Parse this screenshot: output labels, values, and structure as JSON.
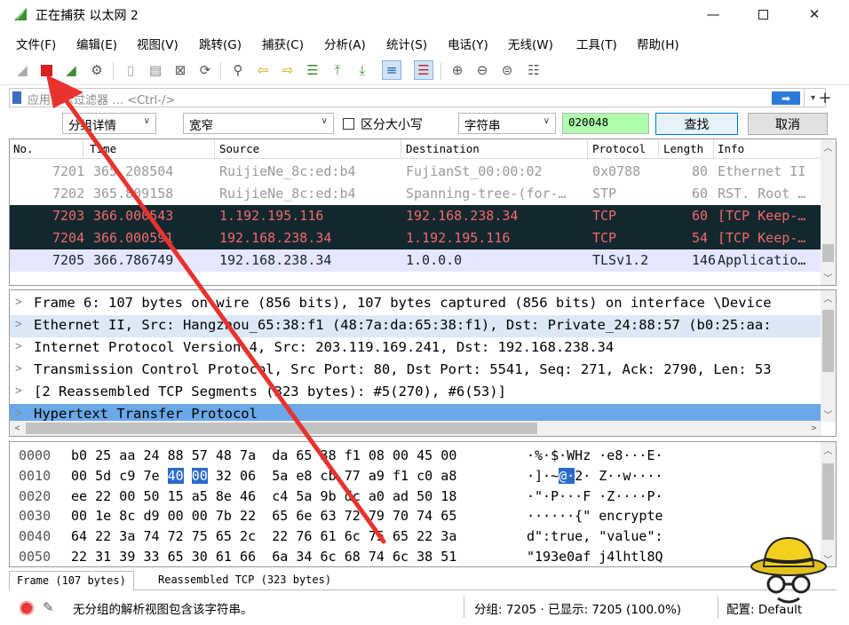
{
  "window": {
    "title": "正在捕获 以太网 2"
  },
  "menubar": [
    {
      "label": "文件(F)"
    },
    {
      "label": "编辑(E)"
    },
    {
      "label": "视图(V)"
    },
    {
      "label": "跳转(G)"
    },
    {
      "label": "捕获(C)"
    },
    {
      "label": "分析(A)"
    },
    {
      "label": "统计(S)"
    },
    {
      "label": "电话(Y)"
    },
    {
      "label": "无线(W)"
    },
    {
      "label": "工具(T)"
    },
    {
      "label": "帮助(H)"
    }
  ],
  "filter": {
    "placeholder": "应用显示过滤器 … <Ctrl-/>"
  },
  "find": {
    "scope": "分组详情",
    "charset": "宽窄",
    "case_label": "区分大小写",
    "type": "字符串",
    "value": "020048",
    "find_button": "查找",
    "cancel_button": "取消"
  },
  "columns": [
    "No.",
    "Time",
    "Source",
    "Destination",
    "Protocol",
    "Length",
    "Info"
  ],
  "packets": [
    {
      "no": "7201",
      "time": "365.208504",
      "src": "RuijieNe_8c:ed:b4",
      "dst": "FujianSt_00:00:02",
      "proto": "0x0788",
      "len": "80",
      "info": "Ethernet II"
    },
    {
      "no": "7202",
      "time": "365.809158",
      "src": "RuijieNe_8c:ed:b4",
      "dst": "Spanning-tree-(for-…",
      "proto": "STP",
      "len": "60",
      "info": "RST. Root …"
    },
    {
      "no": "7203",
      "time": "366.000543",
      "src": "1.192.195.116",
      "dst": "192.168.238.34",
      "proto": "TCP",
      "len": "60",
      "info": "[TCP Keep-…"
    },
    {
      "no": "7204",
      "time": "366.000591",
      "src": "192.168.238.34",
      "dst": "1.192.195.116",
      "proto": "TCP",
      "len": "54",
      "info": "[TCP Keep-…"
    },
    {
      "no": "7205",
      "time": "366.786749",
      "src": "192.168.238.34",
      "dst": "1.0.0.0",
      "proto": "TLSv1.2",
      "len": "146",
      "info": "Applicatio…"
    }
  ],
  "details": [
    "Frame 6: 107 bytes on wire (856 bits), 107 bytes captured (856 bits) on interface \\Device",
    "Ethernet II, Src: Hangzhou_65:38:f1 (48:7a:da:65:38:f1), Dst: Private_24:88:57 (b0:25:aa:",
    "Internet Protocol Version 4, Src: 203.119.169.241, Dst: 192.168.238.34",
    "Transmission Control Protocol, Src Port: 80, Dst Port: 5541, Seq: 271, Ack: 2790, Len: 53",
    "[2 Reassembled TCP Segments (323 bytes): #5(270), #6(53)]",
    "Hypertext Transfer Protocol"
  ],
  "bytes_rows": [
    {
      "offset": "0000",
      "hex": [
        "b0",
        "25",
        "aa",
        "24",
        "88",
        "57",
        "48",
        "7a",
        "da",
        "65",
        "38",
        "f1",
        "08",
        "00",
        "45",
        "00"
      ],
      "ascii": "·%·$·WHz ·e8···E·"
    },
    {
      "offset": "0010",
      "hex": [
        "00",
        "5d",
        "c9",
        "7e",
        "40",
        "00",
        "32",
        "06",
        "5a",
        "e8",
        "cb",
        "77",
        "a9",
        "f1",
        "c0",
        "a8"
      ],
      "ascii": "·]·~@·2· Z··w····"
    },
    {
      "offset": "0020",
      "hex": [
        "ee",
        "22",
        "00",
        "50",
        "15",
        "a5",
        "8e",
        "46",
        "c4",
        "5a",
        "9b",
        "dc",
        "a0",
        "ad",
        "50",
        "18"
      ],
      "ascii": "·\"·P···F ·Z····P·"
    },
    {
      "offset": "0030",
      "hex": [
        "00",
        "1e",
        "8c",
        "d9",
        "00",
        "00",
        "7b",
        "22",
        "65",
        "6e",
        "63",
        "72",
        "79",
        "70",
        "74",
        "65"
      ],
      "ascii": "······{\" encrypte"
    },
    {
      "offset": "0040",
      "hex": [
        "64",
        "22",
        "3a",
        "74",
        "72",
        "75",
        "65",
        "2c",
        "22",
        "76",
        "61",
        "6c",
        "75",
        "65",
        "22",
        "3a"
      ],
      "ascii": "d\":true, \"value\":"
    },
    {
      "offset": "0050",
      "hex": [
        "22",
        "31",
        "39",
        "33",
        "65",
        "30",
        "61",
        "66",
        "6a",
        "34",
        "6c",
        "68",
        "74",
        "6c",
        "38",
        "51"
      ],
      "ascii": "\"193e0af j4lhtl8Q"
    }
  ],
  "byte_tabs": [
    {
      "label": "Frame (107 bytes)"
    },
    {
      "label": "Reassembled TCP (323 bytes)"
    }
  ],
  "status": {
    "message": "无分组的解析视图包含该字符串。",
    "packets": "分组: 7205 · 已显示: 7205 (100.0%)",
    "profile": "配置: Default"
  },
  "colors": {
    "accent": "#3a8f2f",
    "selected": "#2a6acb",
    "dark_row": "#12272e",
    "arrow": "#e8322e"
  }
}
